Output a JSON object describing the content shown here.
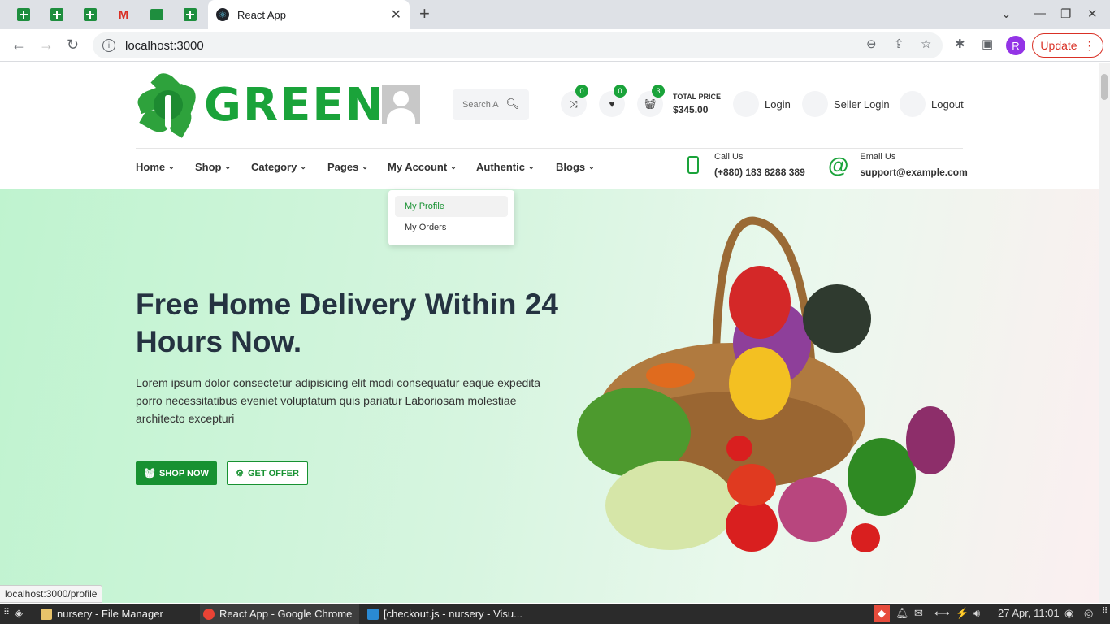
{
  "browser": {
    "active_tab_title": "React App",
    "url": "localhost:3000",
    "update_label": "Update",
    "profile_initial": "R",
    "status_url": "localhost:3000/profile"
  },
  "header": {
    "logo_text": "GREENY",
    "search_placeholder": "Search A",
    "compare_count": "0",
    "wishlist_count": "0",
    "cart_count": "3",
    "total_price_label": "TOTAL PRICE",
    "total_price_value": "$345.00",
    "login_label": "Login",
    "seller_login_label": "Seller Login",
    "logout_label": "Logout"
  },
  "nav": {
    "items": [
      "Home",
      "Shop",
      "Category",
      "Pages",
      "My Account",
      "Authentic",
      "Blogs"
    ],
    "call_label": "Call Us",
    "call_value": "(+880) 183 8288 389",
    "email_label": "Email Us",
    "email_value": "support@example.com"
  },
  "dropdown": {
    "items": [
      "My Profile",
      "My Orders"
    ]
  },
  "hero": {
    "title": "Free Home Delivery Within 24 Hours Now.",
    "description": "Lorem ipsum dolor consectetur adipisicing elit modi consequatur eaque expedita porro necessitatibus eveniet voluptatum quis pariatur Laboriosam molestiae architecto excepturi",
    "shop_now_label": "SHOP NOW",
    "get_offer_label": "GET OFFER"
  },
  "taskbar": {
    "items": [
      "nursery - File Manager",
      "React App - Google Chrome",
      "[checkout.js - nursery - Visu..."
    ],
    "clock": "27 Apr, 11:01"
  },
  "colors": {
    "brand_green": "#1aa33a",
    "button_green": "#179131",
    "hero_text": "#253341"
  }
}
